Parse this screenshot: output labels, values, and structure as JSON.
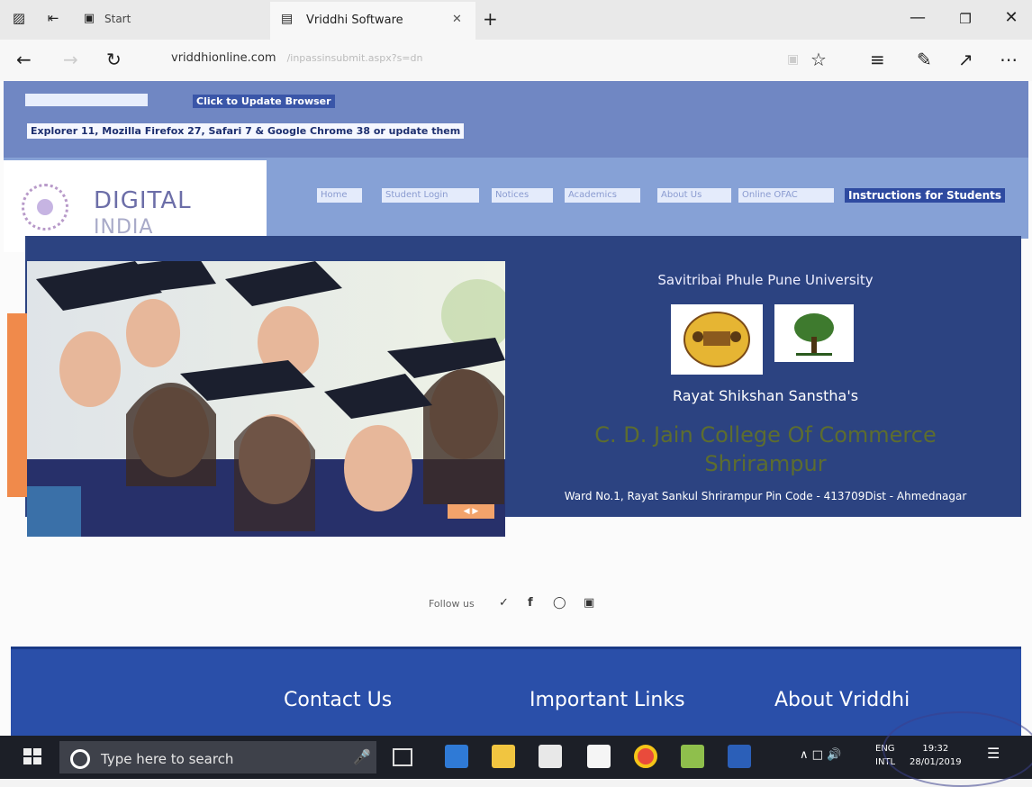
{
  "browser": {
    "prev_tab_label": "Start",
    "active_tab_title": "Vriddhi Software",
    "url": "vriddhionline.com",
    "url_faint": "/inpassinsubmit.aspx?s=dn",
    "icons": {
      "back": "back-arrow-icon",
      "forward": "forward-arrow-icon",
      "refresh": "refresh-icon",
      "favorite": "star-icon",
      "hub": "hub-icon",
      "notes": "pen-icon",
      "share": "share-icon",
      "more": "more-icon"
    }
  },
  "site": {
    "update_button": "Click to Update Browser",
    "browser_message": "Explorer 11, Mozilla Firefox 27, Safari 7 & Google Chrome 38 or update them",
    "logo_line1": "DIGITAL",
    "logo_line2": "INDIA",
    "menu": [
      "Home",
      "Student Login",
      "Notices",
      "Academics",
      "About Us",
      "Online OFAC"
    ],
    "menu_instructions": "Instructions for Students",
    "university": "Savitribai Phule Pune University",
    "society": "Rayat Shikshan Sanstha's",
    "college_line1": "C. D. Jain College Of Commerce",
    "college_line2": "Shrirampur",
    "address": "Ward No.1, Rayat Sankul Shrirampur Pin Code - 413709Dist - Ahmednagar",
    "follow_us": "Follow us",
    "footer": {
      "contact": "Contact Us",
      "links": "Important Links",
      "about": "About Vriddhi"
    }
  },
  "taskbar": {
    "search_placeholder": "Type here to search",
    "lang_line1": "ENG",
    "lang_line2": "INTL",
    "time": "19:32",
    "date": "28/01/2019"
  },
  "colors": {
    "banner": "#7087c3",
    "panel": "#2c4381",
    "footer": "#2a4fa9",
    "accent_orange": "#f08a4b",
    "taskbar": "#1c1f27"
  }
}
